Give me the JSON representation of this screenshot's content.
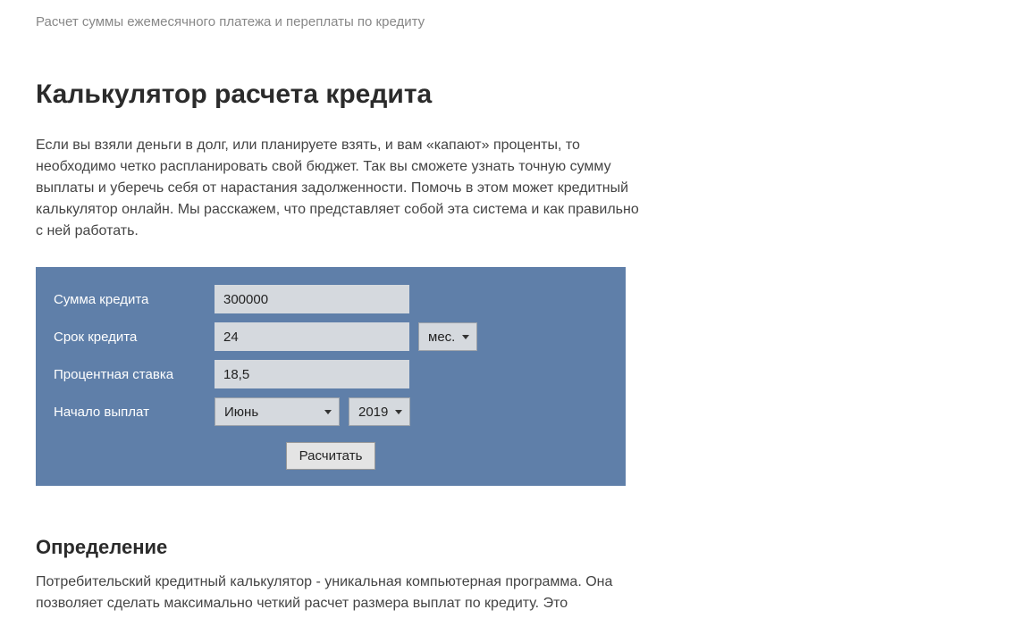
{
  "subtitle": "Расчет суммы ежемесячного платежа и переплаты по кредиту",
  "title": "Калькулятор расчета кредита",
  "intro": "Если вы взяли деньги в долг, или планируете взять, и вам «капают» проценты, то необходимо четко распланировать свой бюджет. Так вы сможете узнать точную сумму выплаты и уберечь себя от нарастания задолженности. Помочь в этом может кредитный калькулятор онлайн. Мы расскажем, что представляет собой эта система и как правильно с ней работать.",
  "calc": {
    "labels": {
      "amount": "Сумма кредита",
      "term": "Срок кредита",
      "rate": "Процентная ставка",
      "start": "Начало выплат"
    },
    "values": {
      "amount": "300000",
      "term": "24",
      "term_unit": "мес.",
      "rate": "18,5",
      "start_month": "Июнь",
      "start_year": "2019"
    },
    "submit_label": "Расчитать"
  },
  "section2": {
    "heading": "Определение",
    "text": "Потребительский кредитный калькулятор - уникальная компьютерная программа. Она позволяет сделать максимально четкий расчет размера выплат по кредиту. Это"
  }
}
